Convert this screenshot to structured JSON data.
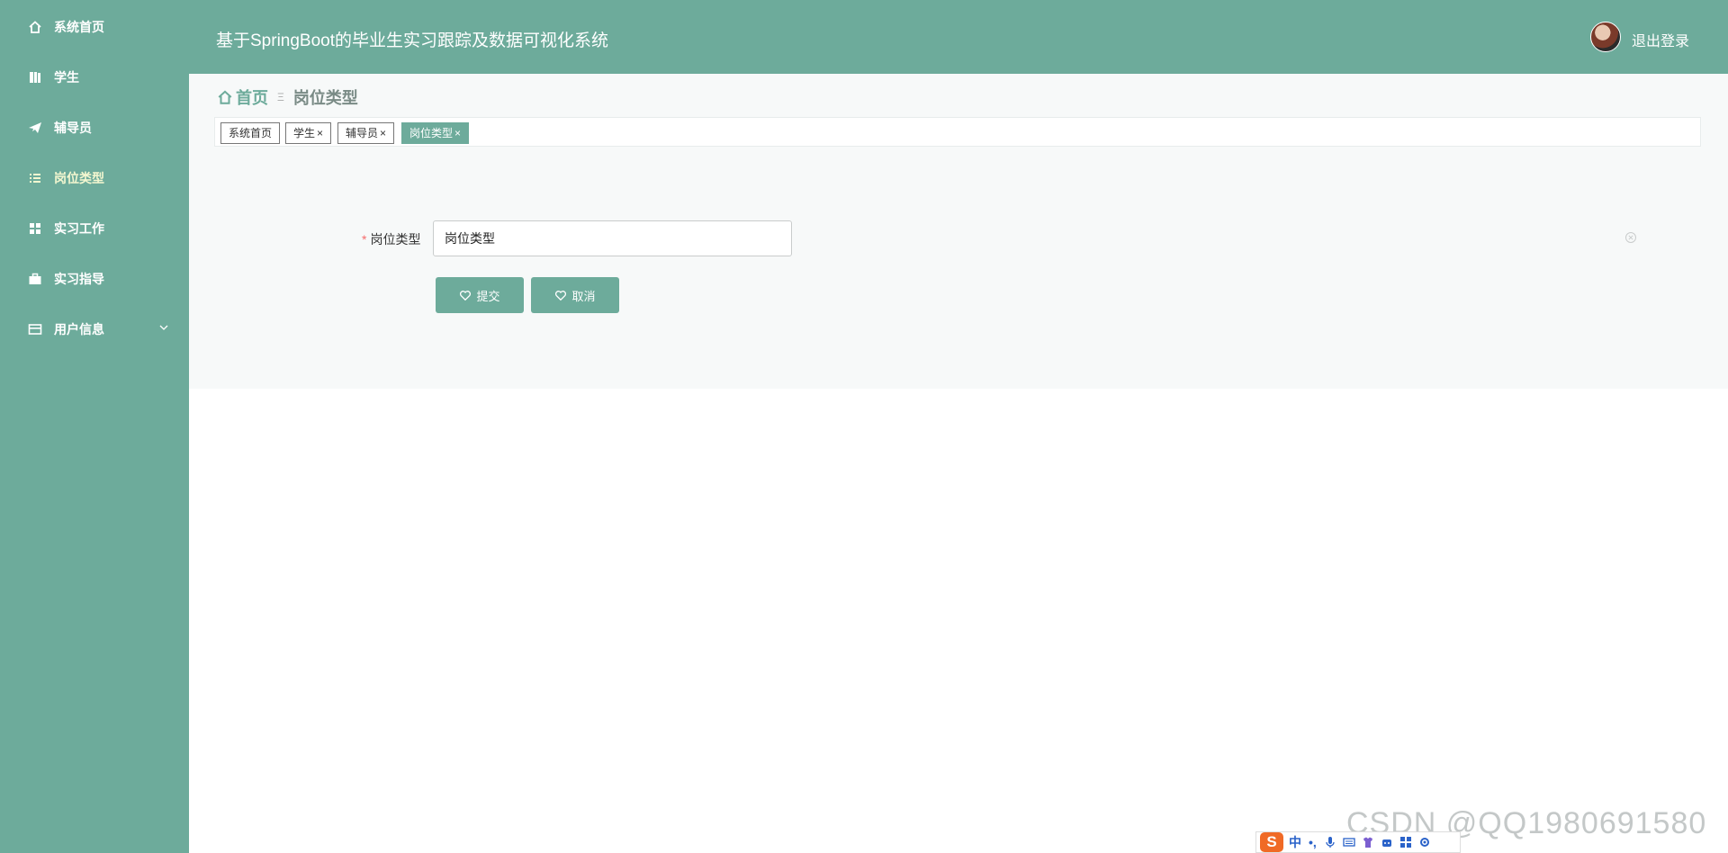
{
  "sidebar": {
    "items": [
      {
        "label": "系统首页",
        "icon": "home-icon"
      },
      {
        "label": "学生",
        "icon": "book-icon"
      },
      {
        "label": "辅导员",
        "icon": "paper-plane-icon"
      },
      {
        "label": "岗位类型",
        "icon": "list-icon",
        "active": true
      },
      {
        "label": "实习工作",
        "icon": "grid-icon"
      },
      {
        "label": "实习指导",
        "icon": "briefcase-icon"
      },
      {
        "label": "用户信息",
        "icon": "card-icon"
      }
    ]
  },
  "header": {
    "title": "基于SpringBoot的毕业生实习跟踪及数据可视化系统",
    "logout_label": "退出登录"
  },
  "breadcrumb": {
    "home": "首页",
    "separator": "Ξ",
    "current": "岗位类型"
  },
  "tags": [
    {
      "label": "系统首页",
      "closable": false
    },
    {
      "label": "学生",
      "closable": true
    },
    {
      "label": "辅导员",
      "closable": true
    },
    {
      "label": "岗位类型",
      "closable": true,
      "active": true
    }
  ],
  "form": {
    "required_mark": "*",
    "field_label": "岗位类型",
    "field_value": "岗位类型",
    "submit_label": "提交",
    "cancel_label": "取消"
  },
  "overlay": {
    "watermark": "CSDN @QQ1980691580",
    "ime_logo": "S",
    "ime_mode": "中",
    "ime_punct": "•,"
  },
  "colors": {
    "primary": "#6dab9b",
    "required": "#f56c6c",
    "active_menu_text": "#f3f7d0"
  }
}
